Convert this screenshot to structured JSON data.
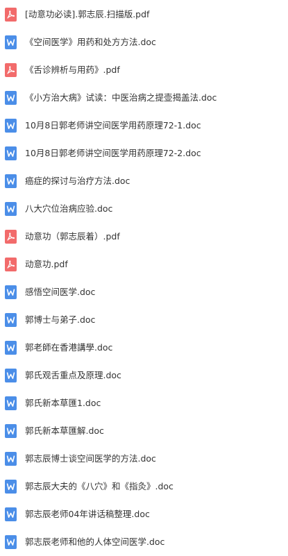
{
  "colors": {
    "pdf": "#f26b6b",
    "doc": "#4b8ee8",
    "text": "#333333"
  },
  "files": [
    {
      "name": "[动意功必读].郭志辰.扫描版.pdf",
      "type": "pdf",
      "icon": "pdf-icon"
    },
    {
      "name": "《空间医学》用药和处方方法.doc",
      "type": "doc",
      "icon": "word-doc-icon"
    },
    {
      "name": "《舌诊辨析与用药》.pdf",
      "type": "pdf",
      "icon": "pdf-icon"
    },
    {
      "name": "《小方治大病》试读：中医治病之提壶揭盖法.doc",
      "type": "doc",
      "icon": "word-doc-icon"
    },
    {
      "name": "10月8日郭老师讲空间医学用药原理72-1.doc",
      "type": "doc",
      "icon": "word-doc-icon"
    },
    {
      "name": "10月8日郭老师讲空间医学用药原理72-2.doc",
      "type": "doc",
      "icon": "word-doc-icon"
    },
    {
      "name": "癌症的探讨与治疗方法.doc",
      "type": "doc",
      "icon": "word-doc-icon"
    },
    {
      "name": "八大穴位治病应验.doc",
      "type": "doc",
      "icon": "word-doc-icon"
    },
    {
      "name": "动意功（郭志辰着）.pdf",
      "type": "pdf",
      "icon": "pdf-icon"
    },
    {
      "name": "动意功.pdf",
      "type": "pdf",
      "icon": "pdf-icon"
    },
    {
      "name": "感悟空间医学.doc",
      "type": "doc",
      "icon": "word-doc-icon"
    },
    {
      "name": "郭博士与弟子.doc",
      "type": "doc",
      "icon": "word-doc-icon"
    },
    {
      "name": "郭老師在香港講學.doc",
      "type": "doc",
      "icon": "word-doc-icon"
    },
    {
      "name": "郭氏观舌重点及原理.doc",
      "type": "doc",
      "icon": "word-doc-icon"
    },
    {
      "name": "郭氏新本草匯1.doc",
      "type": "doc",
      "icon": "word-doc-icon"
    },
    {
      "name": "郭氏新本草匯解.doc",
      "type": "doc",
      "icon": "word-doc-icon"
    },
    {
      "name": "郭志辰博士谈空间医学的方法.doc",
      "type": "doc",
      "icon": "word-doc-icon"
    },
    {
      "name": "郭志辰大夫的《八穴》和《指灸》.doc",
      "type": "doc",
      "icon": "word-doc-icon"
    },
    {
      "name": "郭志辰老师04年讲话稿整理.doc",
      "type": "doc",
      "icon": "word-doc-icon"
    },
    {
      "name": "郭志辰老师和他的人体空间医学.doc",
      "type": "doc",
      "icon": "word-doc-icon"
    }
  ]
}
